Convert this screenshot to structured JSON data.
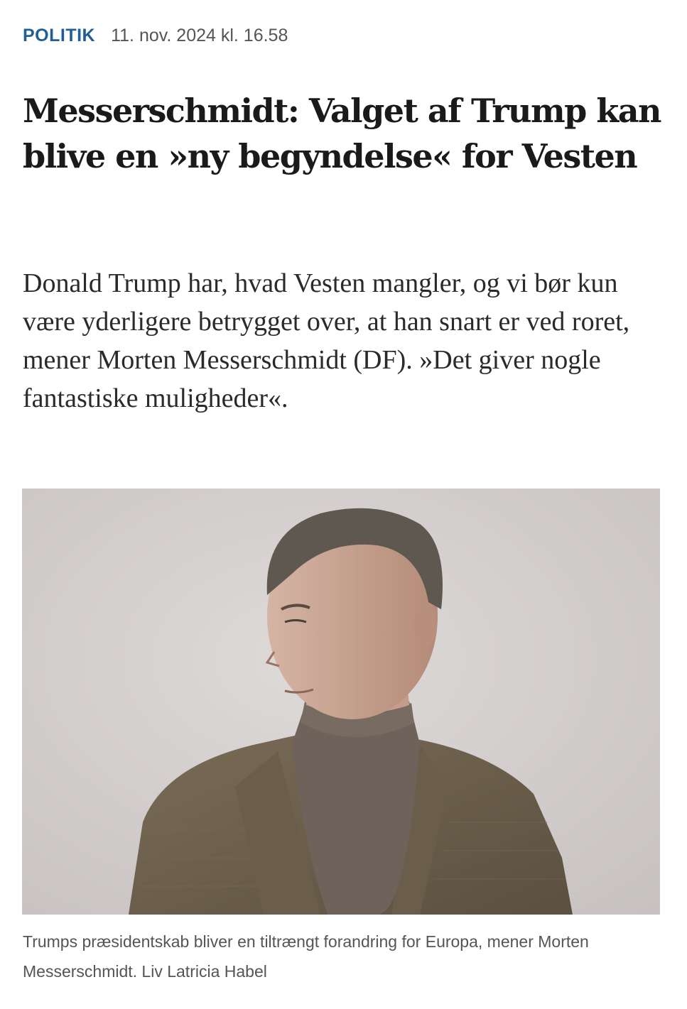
{
  "article": {
    "section": "POLITIK",
    "timestamp": "11. nov. 2024 kl. 16.58",
    "headline": "Messerschmidt: Valget af Trump kan blive en »ny begyndelse« for Vesten",
    "lead": "Donald Trump har, hvad Vesten mangler, og vi bør kun være yderligere betrygget over, at han snart er ved roret, mener Morten Messerschmidt (DF). »Det giver nogle fantastiske muligheder«.",
    "caption": "Trumps præsidentskab bliver en tiltrængt forandring for Europa, mener Morten Messerschmidt. Liv Latricia Habel"
  },
  "colors": {
    "section_link": "#1f5f96",
    "meta_text": "#555555",
    "headline": "#1a1a1a",
    "photo_background": "#d3cfcf",
    "jacket": "#6b5f4c",
    "turtleneck": "#6e625a",
    "hair": "#5e5850"
  },
  "photo": {
    "subject": "portrait of a man in a tweed jacket and turtleneck"
  }
}
